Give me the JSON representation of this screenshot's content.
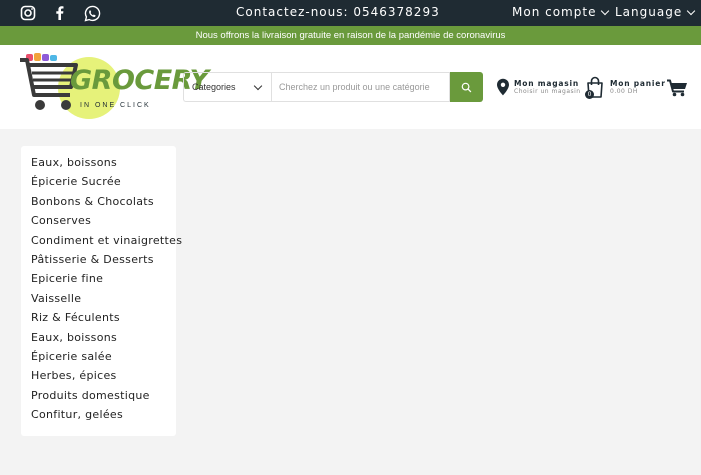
{
  "topbar": {
    "contact": "Contactez-nous: 0546378293",
    "account": "Mon compte",
    "language": "Language",
    "social": [
      "instagram-icon",
      "facebook-icon",
      "whatsapp-icon"
    ]
  },
  "notice": "Nous offrons la livraison gratuite en raison de la pandémie de coronavirus",
  "logo": {
    "brand": "GROCERY",
    "tagline": "IN ONE CLICK"
  },
  "search": {
    "category_label": "Categories",
    "placeholder": "Cherchez un produit ou une catégorie"
  },
  "store": {
    "title": "Mon magasin",
    "subtitle": "Choisir un magasin"
  },
  "cart": {
    "title": "Mon panier",
    "amount": "0.00 DH",
    "count": "0"
  },
  "categories": [
    "Eaux, boissons",
    "Épicerie Sucrée",
    "Bonbons & Chocolats",
    "Conserves",
    "Condiment et vinaigrettes",
    "Pâtisserie & Desserts",
    "Epicerie fine",
    "Vaisselle",
    "Riz & Féculents",
    "Eaux, boissons",
    "Épicerie salée",
    "Herbes, épices",
    "Produits domestique",
    "Confitur, gelées"
  ],
  "colors": {
    "dark": "#1f2b33",
    "green": "#6a9a3c",
    "background": "#f3f3f3"
  }
}
